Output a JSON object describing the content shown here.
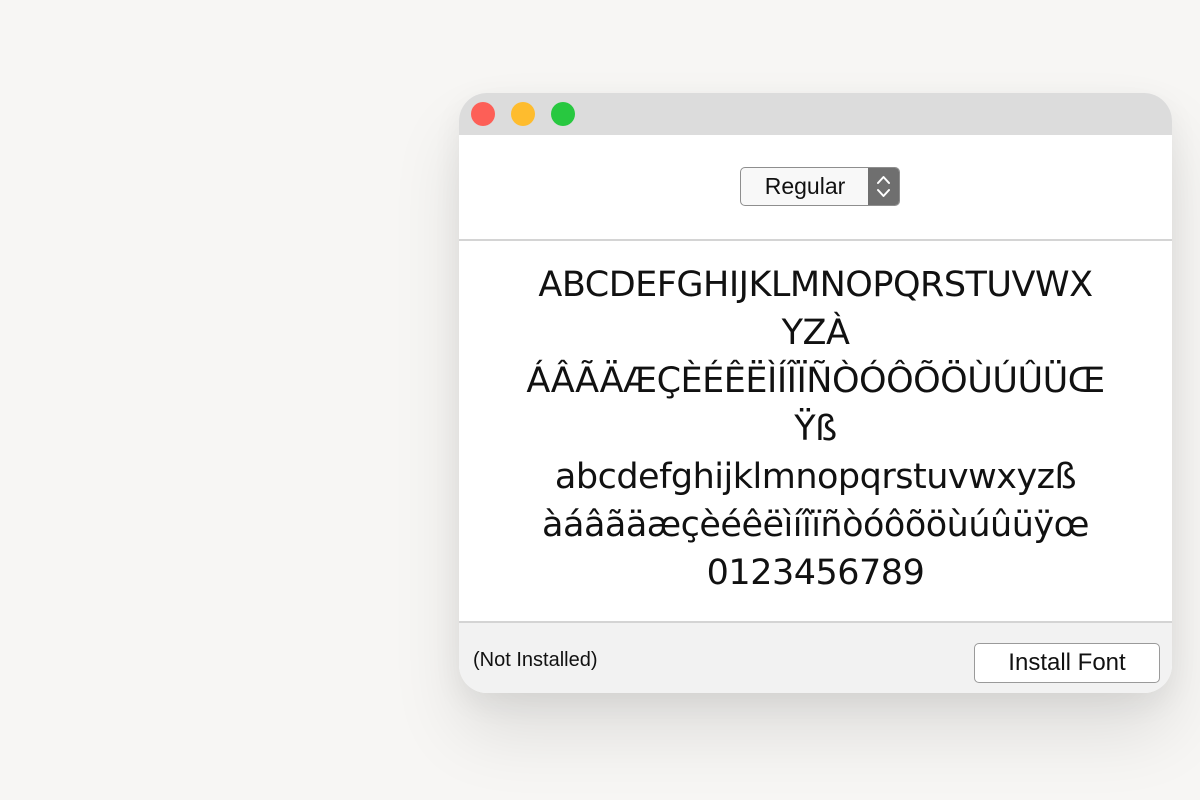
{
  "window": {
    "controls": {
      "close_color": "#fd5f57",
      "minimize_color": "#febc2e",
      "zoom_color": "#28c840"
    }
  },
  "header": {
    "style_select": {
      "selected": "Regular",
      "stepper_icon": "up-down-chevron-icon"
    }
  },
  "preview": {
    "lines": [
      "ABCDEFGHIJKLMNOPQRSTUVWX",
      "YZÀ",
      "ÁÂÃÄÆÇÈÉÊËÌÍÎÏÑÒÓÔÕÖÙÚÛÜŒ",
      "Ÿß",
      "abcdefghijklmnopqrstuvwxyzß",
      "àáâãäæçèéêëìíîïñòóôõöùúûüÿœ",
      "0123456789"
    ]
  },
  "footer": {
    "status": "(Not Installed)",
    "install_label": "Install Font"
  }
}
